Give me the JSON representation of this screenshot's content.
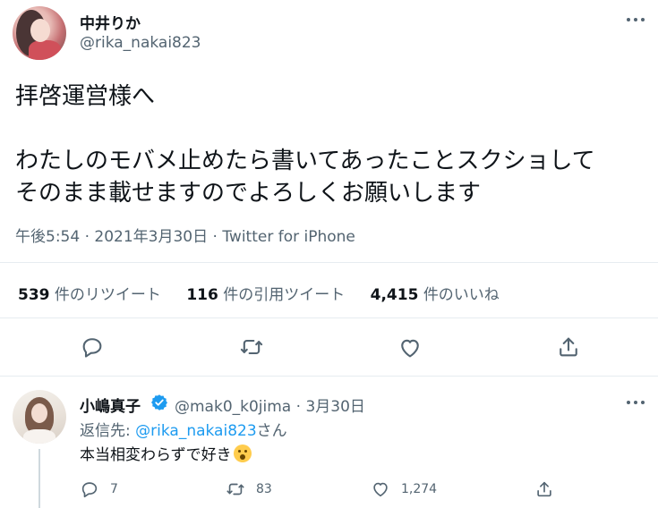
{
  "main_tweet": {
    "display_name": "中井りか",
    "handle": "@rika_nakai823",
    "body": "拝啓運営様へ\n\nわたしのモバメ止めたら書いてあったことスクショして\nそのまま載せますのでよろしくお願いします",
    "time": "午後5:54",
    "date": "2021年3月30日",
    "source": "Twitter for iPhone",
    "separator": "·",
    "stats": {
      "retweets": "539",
      "retweets_label": "件のリツイート",
      "quotes": "116",
      "quotes_label": "件の引用ツイート",
      "likes": "4,415",
      "likes_label": "件のいいね"
    },
    "icons": [
      "more-icon",
      "reply-icon",
      "retweet-icon",
      "like-icon",
      "share-icon"
    ]
  },
  "reply_tweet": {
    "display_name": "小嶋真子",
    "handle": "@mak0_k0jima",
    "date": "3月30日",
    "separator": "·",
    "reply_to_prefix": "返信先:",
    "reply_to_mention": "@rika_nakai823",
    "reply_to_suffix": "さん",
    "text": "本当相変わらずで好き",
    "counts": {
      "replies": "7",
      "retweets": "83",
      "likes": "1,274"
    },
    "icons": [
      "verified-badge-icon",
      "more-icon",
      "astonished-face-emoji",
      "reply-icon",
      "retweet-icon",
      "like-icon",
      "share-icon"
    ]
  },
  "colors": {
    "text": "#0f1419",
    "secondary": "#536471",
    "link": "#1d9bf0",
    "divider": "#e6ecf0",
    "verified": "#1d9bf0"
  }
}
